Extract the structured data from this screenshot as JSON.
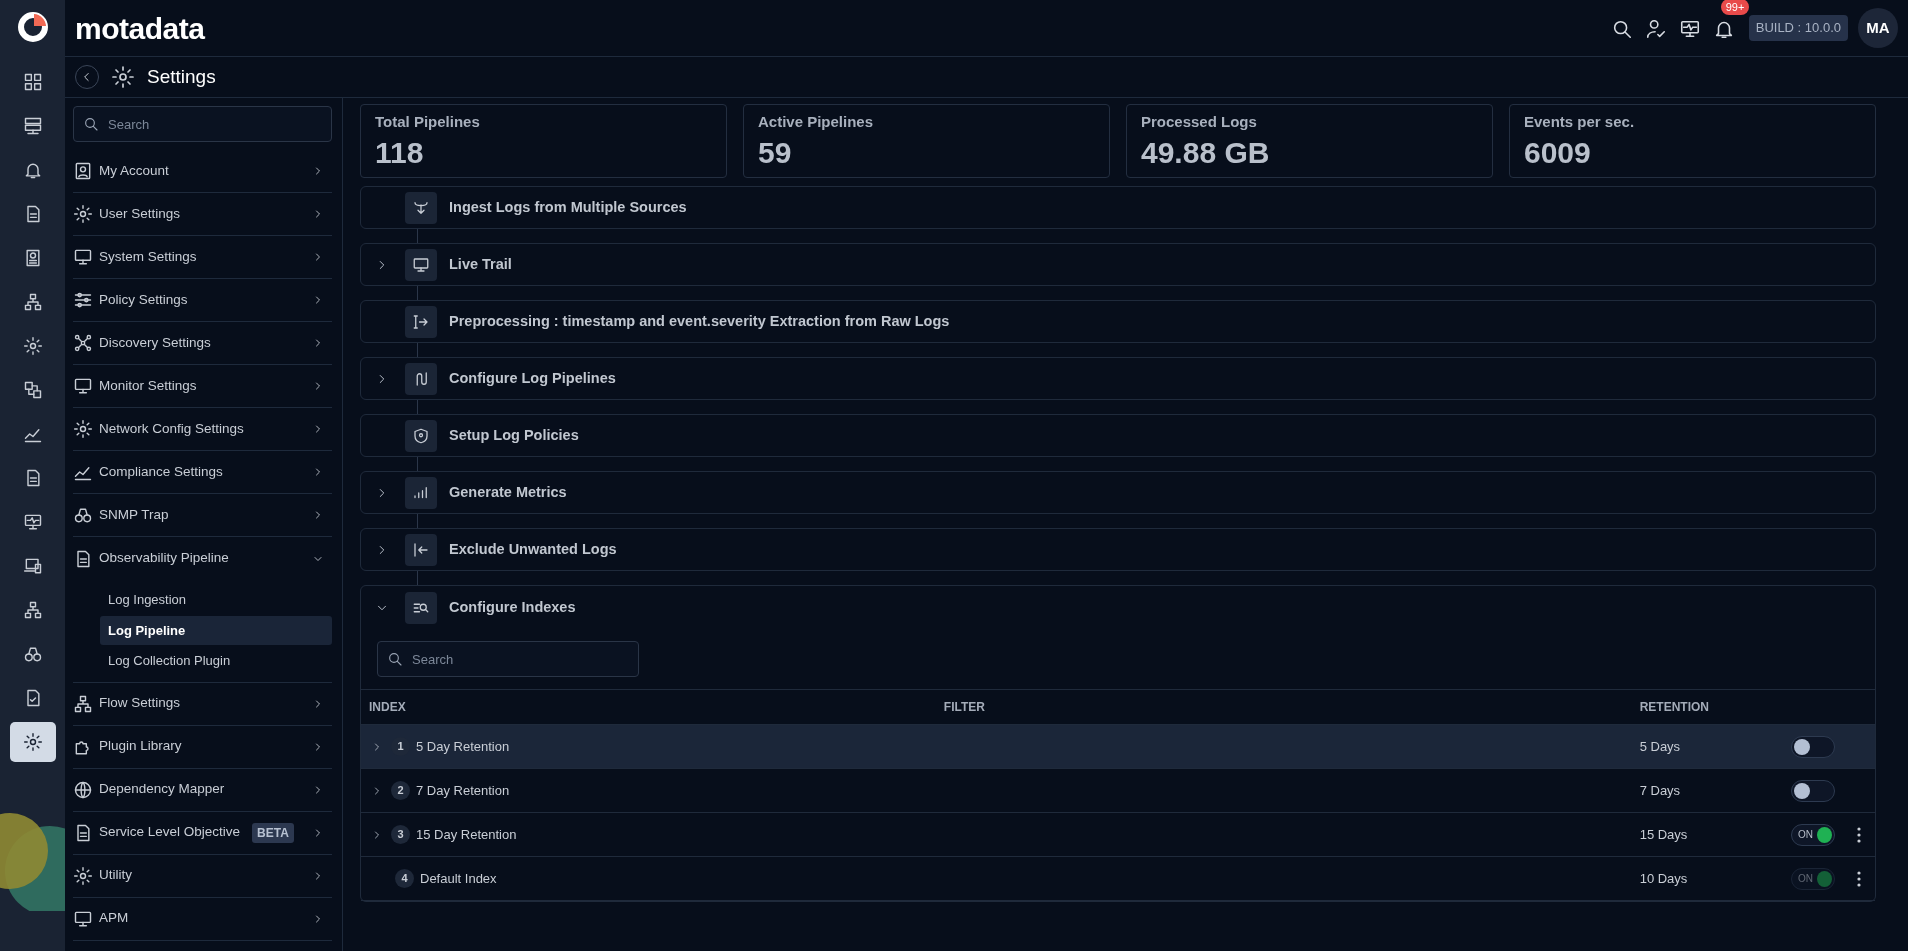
{
  "brand": {
    "name": "motadata"
  },
  "header": {
    "notification_count": "99+",
    "build": "BUILD : 10.0.0",
    "avatar": "MA"
  },
  "rail": [
    {
      "selected": false
    },
    {
      "selected": false
    },
    {
      "selected": false
    },
    {
      "selected": false
    },
    {
      "selected": false
    },
    {
      "selected": false
    },
    {
      "selected": false
    },
    {
      "selected": false
    },
    {
      "selected": false
    },
    {
      "selected": false
    },
    {
      "selected": false
    },
    {
      "selected": false
    },
    {
      "selected": false
    },
    {
      "selected": false
    },
    {
      "selected": false
    },
    {
      "selected": true
    }
  ],
  "page_title": "Settings",
  "sidebar": {
    "search_placeholder": "Search",
    "items": [
      {
        "label": "My Account",
        "expanded": false
      },
      {
        "label": "User Settings",
        "expanded": false
      },
      {
        "label": "System Settings",
        "expanded": false
      },
      {
        "label": "Policy Settings",
        "expanded": false
      },
      {
        "label": "Discovery Settings",
        "expanded": false
      },
      {
        "label": "Monitor Settings",
        "expanded": false
      },
      {
        "label": "Network Config Settings",
        "expanded": false
      },
      {
        "label": "Compliance Settings",
        "expanded": false
      },
      {
        "label": "SNMP Trap",
        "expanded": false
      },
      {
        "label": "Observability Pipeline",
        "expanded": true,
        "children": [
          {
            "label": "Log Ingestion",
            "selected": false
          },
          {
            "label": "Log Pipeline",
            "selected": true
          },
          {
            "label": "Log Collection Plugin",
            "selected": false
          }
        ]
      },
      {
        "label": "Flow Settings",
        "expanded": false
      },
      {
        "label": "Plugin Library",
        "expanded": false
      },
      {
        "label": "Dependency Mapper",
        "expanded": false
      },
      {
        "label": "Service Level Objective",
        "expanded": false,
        "badge": "BETA"
      },
      {
        "label": "Utility",
        "expanded": false
      },
      {
        "label": "APM",
        "expanded": false
      }
    ]
  },
  "stats": [
    {
      "label": "Total Pipelines",
      "value": "118"
    },
    {
      "label": "Active Pipelines",
      "value": "59"
    },
    {
      "label": "Processed Logs",
      "value": "49.88 GB"
    },
    {
      "label": "Events per sec.",
      "value": "6009"
    }
  ],
  "steps": [
    {
      "title": "Ingest Logs from Multiple Sources",
      "expandable": false,
      "expanded": false
    },
    {
      "title": "Live Trail",
      "expandable": true,
      "expanded": false
    },
    {
      "title": "Preprocessing : timestamp and event.severity Extraction from Raw Logs",
      "expandable": false,
      "expanded": false
    },
    {
      "title": "Configure Log Pipelines",
      "expandable": true,
      "expanded": false
    },
    {
      "title": "Setup Log Policies",
      "expandable": false,
      "expanded": false
    },
    {
      "title": "Generate Metrics",
      "expandable": true,
      "expanded": false
    },
    {
      "title": "Exclude Unwanted Logs",
      "expandable": true,
      "expanded": false
    },
    {
      "title": "Configure Indexes",
      "expandable": true,
      "expanded": true
    }
  ],
  "indexes": {
    "search_placeholder": "Search",
    "columns": [
      "INDEX",
      "FILTER",
      "RETENTION"
    ],
    "rows": [
      {
        "number": "1",
        "name": "5 Day Retention",
        "retention": "5 Days",
        "expandable": true,
        "selected": true,
        "on": false,
        "disabled": false,
        "menu": false
      },
      {
        "number": "2",
        "name": "7 Day Retention",
        "retention": "7 Days",
        "expandable": true,
        "selected": false,
        "on": false,
        "disabled": false,
        "menu": false
      },
      {
        "number": "3",
        "name": "15 Day Retention",
        "retention": "15 Days",
        "expandable": true,
        "selected": false,
        "on": true,
        "toggle_label": "ON",
        "disabled": false,
        "menu": true
      },
      {
        "number": "4",
        "name": "Default Index",
        "retention": "10 Days",
        "expandable": false,
        "selected": false,
        "on": true,
        "toggle_label": "ON",
        "disabled": true,
        "menu": true
      }
    ]
  }
}
